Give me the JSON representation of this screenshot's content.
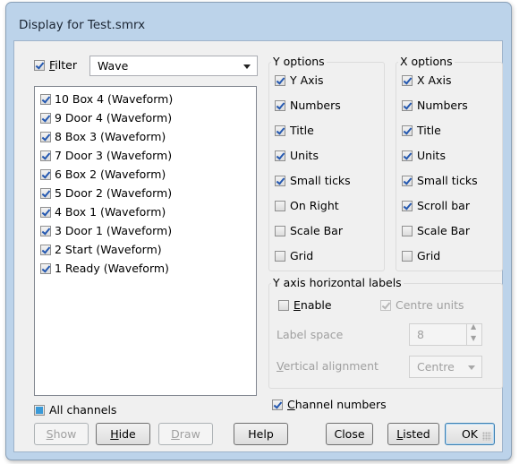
{
  "window": {
    "title": "Display for Test.smrx"
  },
  "filter": {
    "label": "Filter",
    "checked": true,
    "value": "Wave"
  },
  "channels": [
    "10 Box 4 (Waveform)",
    "9 Door 4 (Waveform)",
    "8 Box 3 (Waveform)",
    "7 Door 3 (Waveform)",
    "6 Box 2 (Waveform)",
    "5 Door 2 (Waveform)",
    "4 Box 1 (Waveform)",
    "3 Door 1 (Waveform)",
    "2 Start (Waveform)",
    "1 Ready (Waveform)"
  ],
  "y_options": {
    "title": "Y options",
    "items": [
      {
        "label": "Y Axis",
        "checked": true
      },
      {
        "label": "Numbers",
        "checked": true
      },
      {
        "label": "Title",
        "checked": true
      },
      {
        "label": "Units",
        "checked": true
      },
      {
        "label": "Small ticks",
        "checked": true
      },
      {
        "label": "On Right",
        "checked": false
      },
      {
        "label": "Scale Bar",
        "checked": false
      },
      {
        "label": "Grid",
        "checked": false
      }
    ]
  },
  "x_options": {
    "title": "X options",
    "items": [
      {
        "label": "X Axis",
        "checked": true
      },
      {
        "label": "Numbers",
        "checked": true
      },
      {
        "label": "Title",
        "checked": true
      },
      {
        "label": "Units",
        "checked": true
      },
      {
        "label": "Small ticks",
        "checked": true
      },
      {
        "label": "Scroll bar",
        "checked": true
      },
      {
        "label": "Scale Bar",
        "checked": false
      },
      {
        "label": "Grid",
        "checked": false
      }
    ]
  },
  "y_labels": {
    "title": "Y axis horizontal labels",
    "enable_label": "Enable",
    "centre_units_label": "Centre units",
    "label_space_label": "Label space",
    "label_space_value": "8",
    "vertical_alignment_label": "Vertical alignment",
    "vertical_alignment_value": "Centre"
  },
  "all_channels": {
    "label": "All channels"
  },
  "channel_numbers": {
    "label": "Channel numbers",
    "checked": true
  },
  "buttons": {
    "show": "Show",
    "hide": "Hide",
    "draw": "Draw",
    "help": "Help",
    "close": "Close",
    "listed": "Listed",
    "ok": "OK"
  }
}
